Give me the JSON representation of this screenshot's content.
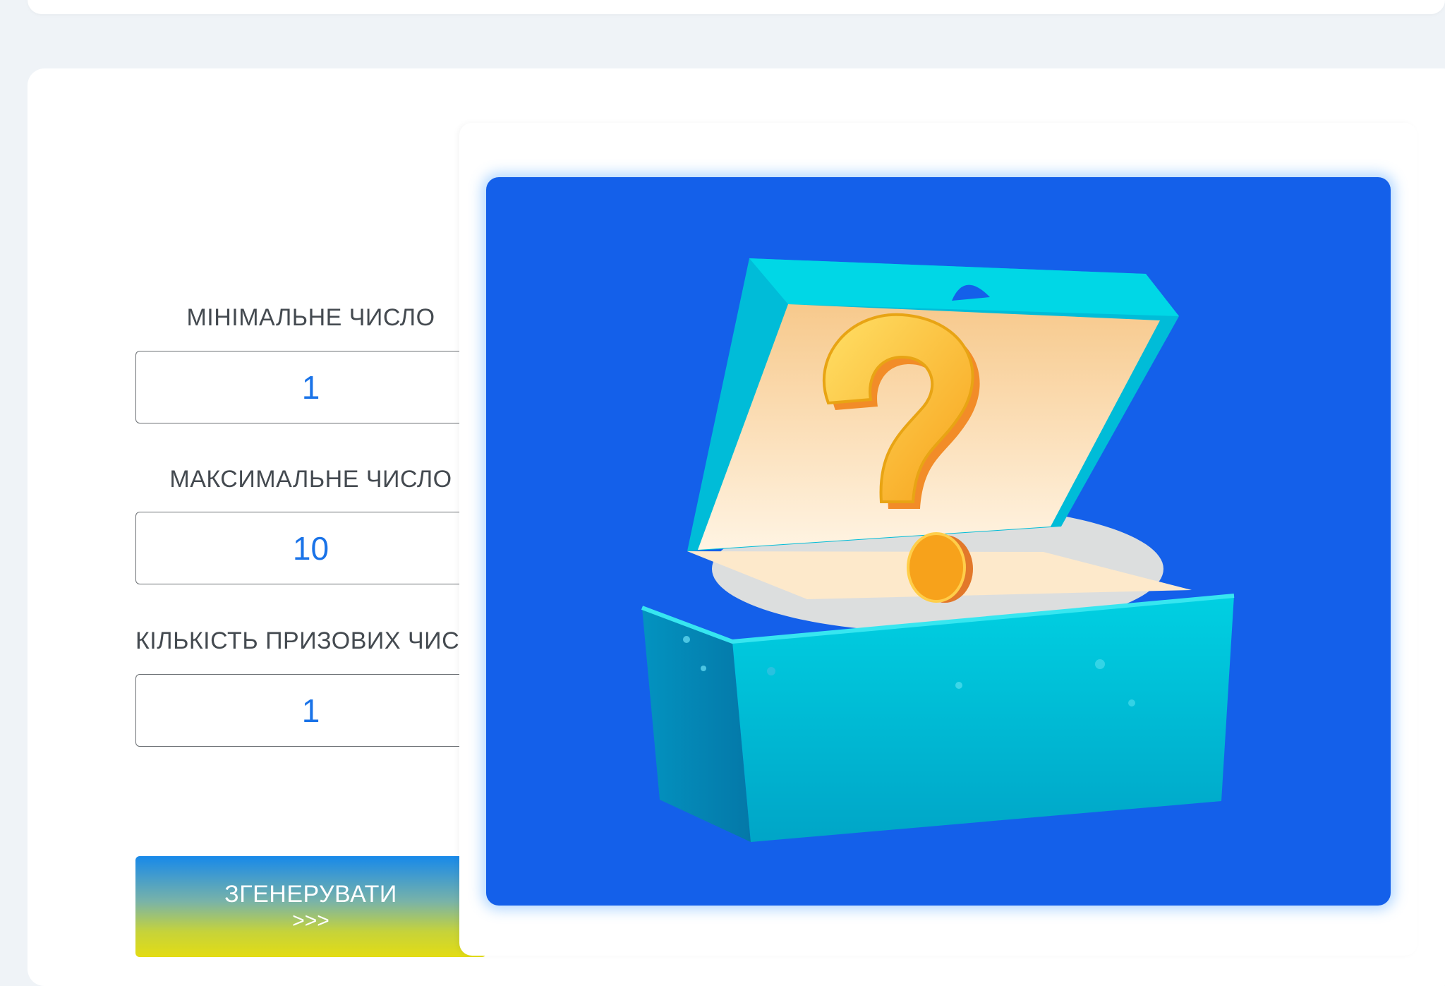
{
  "form": {
    "min_label": "МІНІМАЛЬНЕ ЧИСЛО",
    "min_value": "1",
    "max_label": "МАКСИМАЛЬНЕ ЧИСЛО",
    "max_value": "10",
    "count_label": "КІЛЬКІСТЬ ПРИЗОВИХ ЧИСЕЛ",
    "count_value": "1"
  },
  "generate_button": {
    "line1": "ЗГЕНЕРУВАТИ",
    "line2": ">>>"
  },
  "illustration": {
    "icon": "mystery-chest-question-mark-icon",
    "background_color": "#1460ea",
    "chest_color": "#00b8d4"
  }
}
